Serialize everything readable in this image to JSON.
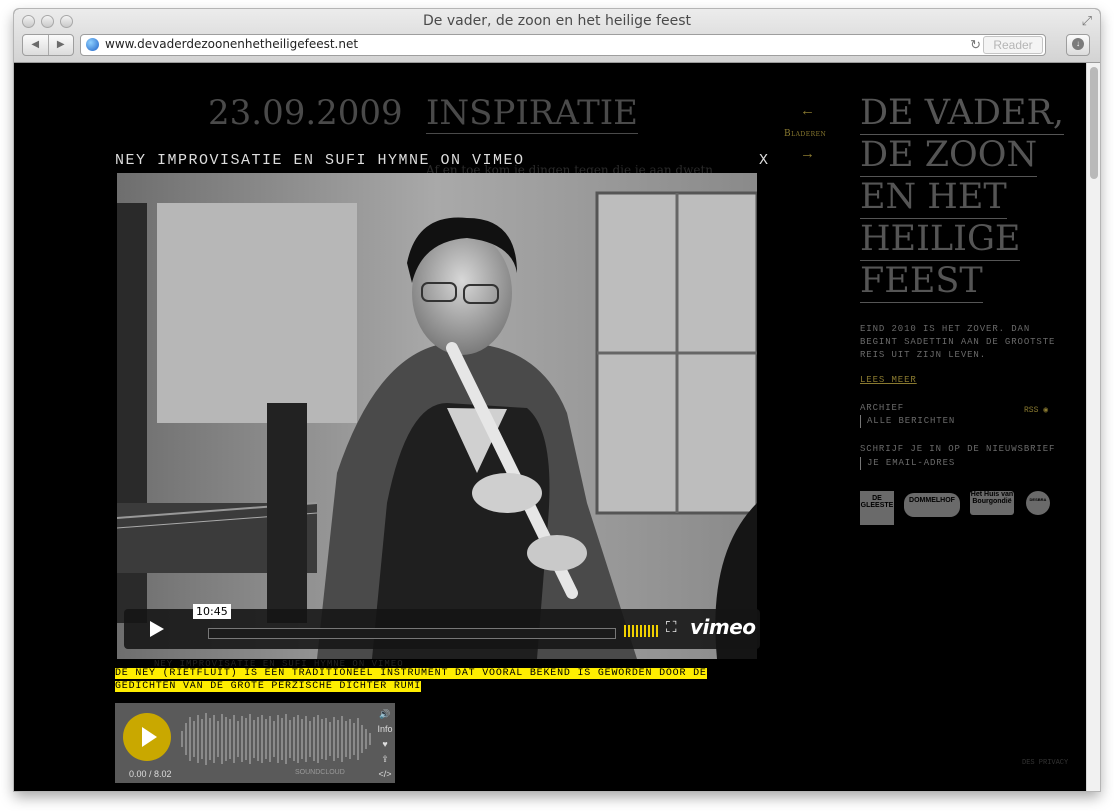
{
  "window": {
    "title": "De vader, de zoon en het heilige feest"
  },
  "toolbar": {
    "back_glyph": "◀",
    "forward_glyph": "▶",
    "url": "www.devaderdezoonenhetheiligefeest.net",
    "reload_glyph": "↻",
    "reader_label": "Reader",
    "download_glyph": "↓",
    "resize_glyph": "⤢"
  },
  "post": {
    "date": "23.09.2009",
    "title": "INSPIRATIE",
    "bleed_text": "Af en toe kom je dingen tegen die je aan dwetn"
  },
  "nav": {
    "prev_glyph": "←",
    "label": "Bladeren",
    "next_glyph": "→"
  },
  "sidebar": {
    "title_lines": [
      "DE VADER,",
      "DE ZOON",
      "EN HET",
      "HEILIGE",
      "FEEST"
    ],
    "intro": "EIND 2010 IS HET ZOVER. DAN BEGINT SADETTIN AAN DE GROOTSTE REIS UIT ZIJN LEVEN.",
    "read_more": "LEES MEER",
    "archive_label": "ARCHIEF",
    "archive_link": "ALLE BERICHTEN",
    "rss_label": "RSS",
    "newsletter_label": "SCHRIJF JE IN OP DE NIEUWSBRIEF",
    "email_placeholder": "JE EMAIL-ADRES",
    "sponsors": [
      "DE GLEESTE",
      "DOMMELHOF",
      "Het Huis van Bourgondië",
      "DESBRA"
    ]
  },
  "modal": {
    "title": "NEY IMPROVISATIE EN SUFI HYMNE ON VIMEO",
    "close_label": "X",
    "video": {
      "time_badge": "10:45",
      "brand": "vimeo",
      "fullscreen_glyph": "⛶"
    }
  },
  "post_body": {
    "bleed_caption": "NEY IMPROVISATIE EN SUFI HYMNE ON VIMEO",
    "caption": "DE NEY (RIETFLUIT) IS EEN TRADITIONEEL INSTRUMENT DAT VOORAL BEKEND IS GEWORDEN DOOR DE GEDICHTEN VAN DE GROTE PERZISCHE DICHTER RUMI"
  },
  "audio_player": {
    "time": "0.00 / 8.02",
    "info_label": "Info",
    "footer_label": "SOUNDCLOUD"
  },
  "footer": {
    "copyright": "DES PRIVACY"
  },
  "colors": {
    "background": "#000000",
    "accent": "#8a7a30",
    "highlight": "#ffee00",
    "vimeo_bar": "#f0d000"
  }
}
